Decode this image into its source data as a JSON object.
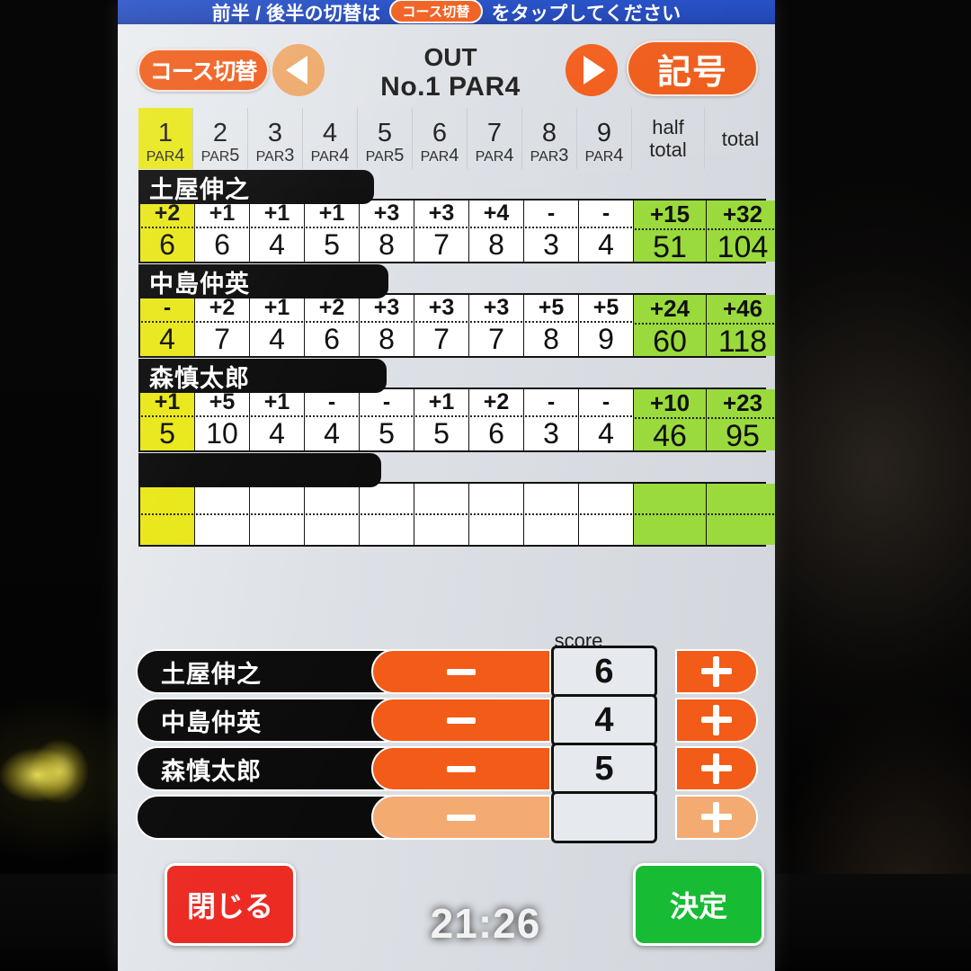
{
  "banner": {
    "text_before": "前半 / 後半の切替は",
    "chip_label": "コース切替",
    "text_after": "をタップしてください"
  },
  "header": {
    "course_switch_label": "コース切替",
    "prev_icon": "triangle-left-icon",
    "next_icon": "triangle-right-icon",
    "nine_label": "OUT",
    "hole_label": "No.1 PAR4",
    "symbol_label": "記号"
  },
  "table": {
    "holes": [
      {
        "num": "1",
        "par_prefix": "PAR",
        "par": "4",
        "current": true
      },
      {
        "num": "2",
        "par_prefix": "PAR",
        "par": "5",
        "current": false
      },
      {
        "num": "3",
        "par_prefix": "PAR",
        "par": "3",
        "current": false
      },
      {
        "num": "4",
        "par_prefix": "PAR",
        "par": "4",
        "current": false
      },
      {
        "num": "5",
        "par_prefix": "PAR",
        "par": "5",
        "current": false
      },
      {
        "num": "6",
        "par_prefix": "PAR",
        "par": "4",
        "current": false
      },
      {
        "num": "7",
        "par_prefix": "PAR",
        "par": "4",
        "current": false
      },
      {
        "num": "8",
        "par_prefix": "PAR",
        "par": "3",
        "current": false
      },
      {
        "num": "9",
        "par_prefix": "PAR",
        "par": "4",
        "current": false
      }
    ],
    "half_total_header": "half total",
    "total_header": "total",
    "players": [
      {
        "name": "土屋伸之",
        "diffs": [
          "+2",
          "+1",
          "+1",
          "+1",
          "+3",
          "+3",
          "+4",
          "-",
          "-"
        ],
        "strokes": [
          "6",
          "6",
          "4",
          "5",
          "8",
          "7",
          "8",
          "3",
          "4"
        ],
        "half_total_diff": "+15",
        "half_total": "51",
        "total_diff": "+32",
        "total": "104"
      },
      {
        "name": "中島仲英",
        "diffs": [
          "-",
          "+2",
          "+1",
          "+2",
          "+3",
          "+3",
          "+3",
          "+5",
          "+5"
        ],
        "strokes": [
          "4",
          "7",
          "4",
          "6",
          "8",
          "7",
          "7",
          "8",
          "9"
        ],
        "half_total_diff": "+24",
        "half_total": "60",
        "total_diff": "+46",
        "total": "118"
      },
      {
        "name": "森慎太郎",
        "diffs": [
          "+1",
          "+5",
          "+1",
          "-",
          "-",
          "+1",
          "+2",
          "-",
          "-"
        ],
        "strokes": [
          "5",
          "10",
          "4",
          "4",
          "5",
          "5",
          "6",
          "3",
          "4"
        ],
        "half_total_diff": "+10",
        "half_total": "46",
        "total_diff": "+23",
        "total": "95"
      },
      {
        "name": "",
        "diffs": [
          "",
          "",
          "",
          "",
          "",
          "",
          "",
          "",
          ""
        ],
        "strokes": [
          "",
          "",
          "",
          "",
          "",
          "",
          "",
          "",
          ""
        ],
        "half_total_diff": "",
        "half_total": "",
        "total_diff": "",
        "total": ""
      }
    ]
  },
  "stepper_section": {
    "score_label": "score",
    "minus_icon": "minus-icon",
    "plus_icon": "plus-icon",
    "rows": [
      {
        "name": "土屋伸之",
        "value": "6",
        "enabled": true
      },
      {
        "name": "中島仲英",
        "value": "4",
        "enabled": true
      },
      {
        "name": "森慎太郎",
        "value": "5",
        "enabled": true
      },
      {
        "name": "",
        "value": "",
        "enabled": false
      }
    ]
  },
  "footer": {
    "close_label": "閉じる",
    "confirm_label": "決定",
    "clock": "21:26"
  },
  "colors": {
    "orange": "#f25b18",
    "orange_disabled": "#f3ab72",
    "yellow_current": "#e9e718",
    "green_total": "#9ada3c",
    "banner_blue": "#1a41b6",
    "red_close": "#ec2b23",
    "green_confirm": "#18bb34",
    "name_tag_black": "#0b0b0b"
  }
}
